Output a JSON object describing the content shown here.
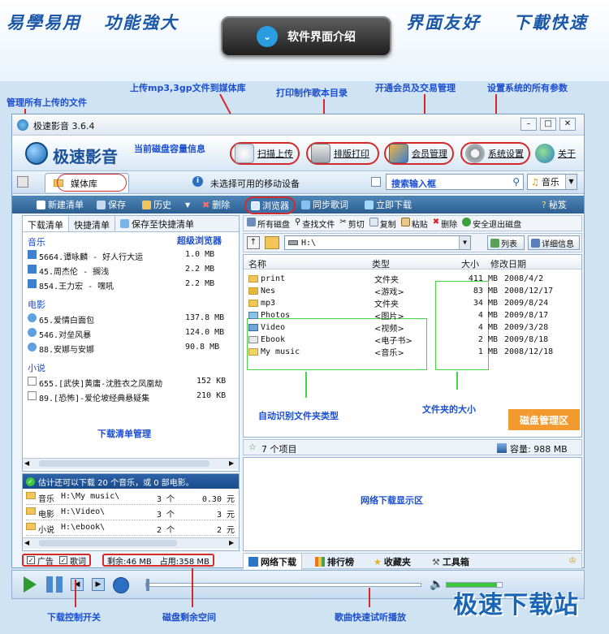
{
  "banner": {
    "slogan_left_1": "易學易用",
    "slogan_left_2": "功能強大",
    "slogan_right_1": "界面友好",
    "slogan_right_2": "下載快速",
    "badge_title": "软件界面介绍"
  },
  "annotations": {
    "manage_uploads": "管理所有上传的文件",
    "upload_mp3": "上传mp3,3gp文件到媒体库",
    "print_catalog": "打印制作歌本目录",
    "member_trade": "开通会员及交易管理",
    "system_settings": "设置系统的所有参数",
    "disk_capacity": "当前磁盘容量信息",
    "search_box": "搜索输入框",
    "super_browser": "超级浏览器",
    "download_list_mgmt": "下载清单管理",
    "auto_folder_type": "自动识别文件夹类型",
    "folder_size": "文件夹的大小",
    "disk_mgmt": "磁盘管理区",
    "net_download_area": "网络下载显示区",
    "download_switch": "下载控制开关",
    "disk_free": "磁盘剩余空间",
    "quick_preview": "歌曲快速试听播放"
  },
  "window": {
    "title": "极速影音 3.6.4",
    "app_name": "极速影音",
    "buttons": {
      "upload": "扫描上传",
      "print": "排版打印",
      "member": "会员管理",
      "settings": "系统设置",
      "about": "关于"
    },
    "media_tab": "媒体库",
    "device_status": "未选择可用的移动设备",
    "search_placeholder": "",
    "search_scope": "音乐"
  },
  "menubar": {
    "new_list": "新建清单",
    "save": "保存",
    "history": "历史",
    "delete": "删除",
    "browser": "浏览器",
    "sync_lyrics": "同步歌词",
    "download_now": "立即下载",
    "secret": "秘笈"
  },
  "left_panel": {
    "tabs": [
      "下载清单",
      "快捷清单",
      "保存至快捷清单"
    ],
    "categories": [
      {
        "name": "音乐",
        "items": [
          {
            "name": "5664.谭咏麟 - 好人行大运",
            "size": "1.0 MB"
          },
          {
            "name": "45.周杰伦 - 搁浅",
            "size": "2.2 MB"
          },
          {
            "name": "854.王力宏 - 嘿吼",
            "size": "2.2 MB"
          }
        ]
      },
      {
        "name": "电影",
        "items": [
          {
            "name": "65.爱情白面包",
            "size": "137.8 MB"
          },
          {
            "name": "546.对垒风暴",
            "size": "124.0 MB"
          },
          {
            "name": "88.安娜与安娜",
            "size": "90.8 MB"
          }
        ]
      },
      {
        "name": "小说",
        "items": [
          {
            "name": "655.[武侠]黄庸-沈胜衣之凤凰劫",
            "size": "152 KB"
          },
          {
            "name": "89.[恐怖]-爱伦坡经典悬疑集",
            "size": "210 KB"
          }
        ]
      }
    ],
    "estimate": "估计还可以下载 20 个音乐，或 0 部电影。",
    "summary_rows": [
      {
        "type": "音乐",
        "path": "H:\\My music\\",
        "count": "3 个",
        "price": "0.30 元"
      },
      {
        "type": "电影",
        "path": "H:\\Video\\",
        "count": "3 个",
        "price": "3 元"
      },
      {
        "type": "小说",
        "path": "H:\\ebook\\",
        "count": "2 个",
        "price": "2 元"
      }
    ],
    "chk_ads": "广告",
    "chk_lyrics": "歌词",
    "free_space": "剩余:46 MB",
    "used_space": "占用:358 MB"
  },
  "right_panel": {
    "toolbar": {
      "all_disks": "所有磁盘",
      "find": "查找文件",
      "cut": "剪切",
      "copy": "复制",
      "paste": "粘贴",
      "delete": "删除",
      "eject": "安全退出磁盘"
    },
    "path": "H:\\",
    "view_list": "列表",
    "view_detail": "详细信息",
    "columns": [
      "名称",
      "类型",
      "大小",
      "修改日期"
    ],
    "files": [
      {
        "name": "print",
        "type": "文件夹",
        "size": "411 MB",
        "date": "2008/4/2"
      },
      {
        "name": "Nes",
        "type": "<游戏>",
        "size": "83 MB",
        "date": "2008/12/17"
      },
      {
        "name": "mp3",
        "type": "文件夹",
        "size": "34 MB",
        "date": "2009/8/24"
      },
      {
        "name": "Photos",
        "type": "<图片>",
        "size": "4 MB",
        "date": "2009/8/17"
      },
      {
        "name": "Video",
        "type": "<视频>",
        "size": "4 MB",
        "date": "2009/3/28"
      },
      {
        "name": "Ebook",
        "type": "<电子书>",
        "size": "2 MB",
        "date": "2009/8/18"
      },
      {
        "name": "My music",
        "type": "<音乐>",
        "size": "1 MB",
        "date": "2008/12/18"
      }
    ],
    "item_count": "7 个项目",
    "capacity": "容量: 988 MB",
    "bottom_tabs": [
      "网络下载",
      "排行榜",
      "收藏夹",
      "工具箱"
    ]
  },
  "watermark": "极速下载站",
  "colors": {
    "annotation": "#1c4fd0",
    "highlight_circle": "#d42a2a",
    "green_box": "#44d644",
    "disk_badge": "#f29a2e"
  }
}
